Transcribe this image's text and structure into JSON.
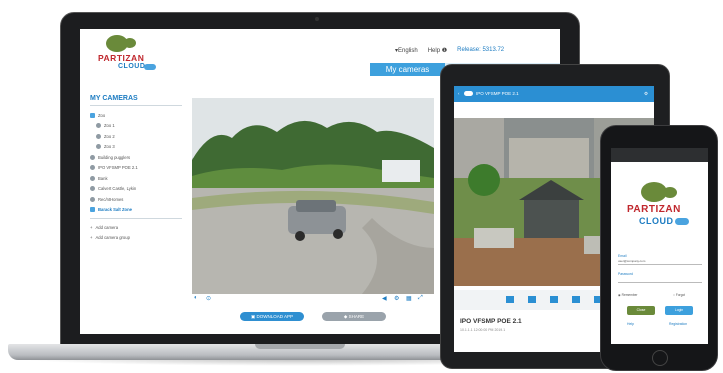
{
  "laptop": {
    "logo": {
      "word1": "PARTIZAN",
      "word2": "CLOUD"
    },
    "topnav": {
      "language": "English",
      "help": "Help",
      "release": "Release: 5313.72"
    },
    "tabs": {
      "active": "My cameras"
    },
    "sidebar": {
      "title": "MY CAMERAS",
      "items": [
        {
          "label": "Zoo"
        },
        {
          "label": "Zoo 1"
        },
        {
          "label": "Zoo 2"
        },
        {
          "label": "Zoo 3"
        },
        {
          "label": "Building pugglers"
        },
        {
          "label": "IPO VFSMP POE 2.1"
        },
        {
          "label": "Bank"
        },
        {
          "label": "Calvert Castle, Lykin"
        },
        {
          "label": "Rec/ntHomes"
        },
        {
          "label": "Barack Salt Zone"
        }
      ],
      "actions": [
        {
          "label": "Add camera"
        },
        {
          "label": "Add camera group"
        }
      ]
    },
    "buttons": {
      "primary": "DOWNLOAD APP",
      "secondary": "SHARE"
    }
  },
  "tablet": {
    "header": "IPO VFSMP POE 2.1",
    "title": "IPO VFSMP POE 2.1",
    "subtitle": "10.1.1.1 12:00:00 PM 2019.1"
  },
  "phone": {
    "logo": {
      "word1": "PARTIZAN",
      "word2": "CLOUD"
    },
    "email_label": "Email",
    "email_value": "user@company.com",
    "password_label": "Password",
    "remember": "Remember",
    "forgot": "Forgot",
    "btn_left": "Close",
    "btn_right": "Login",
    "link_left": "Help",
    "link_right": "Registration"
  },
  "colors": {
    "brand_blue": "#1d7cc2",
    "brand_red": "#c0272d",
    "brand_green": "#6a8a3a",
    "accent": "#3da0dd"
  }
}
